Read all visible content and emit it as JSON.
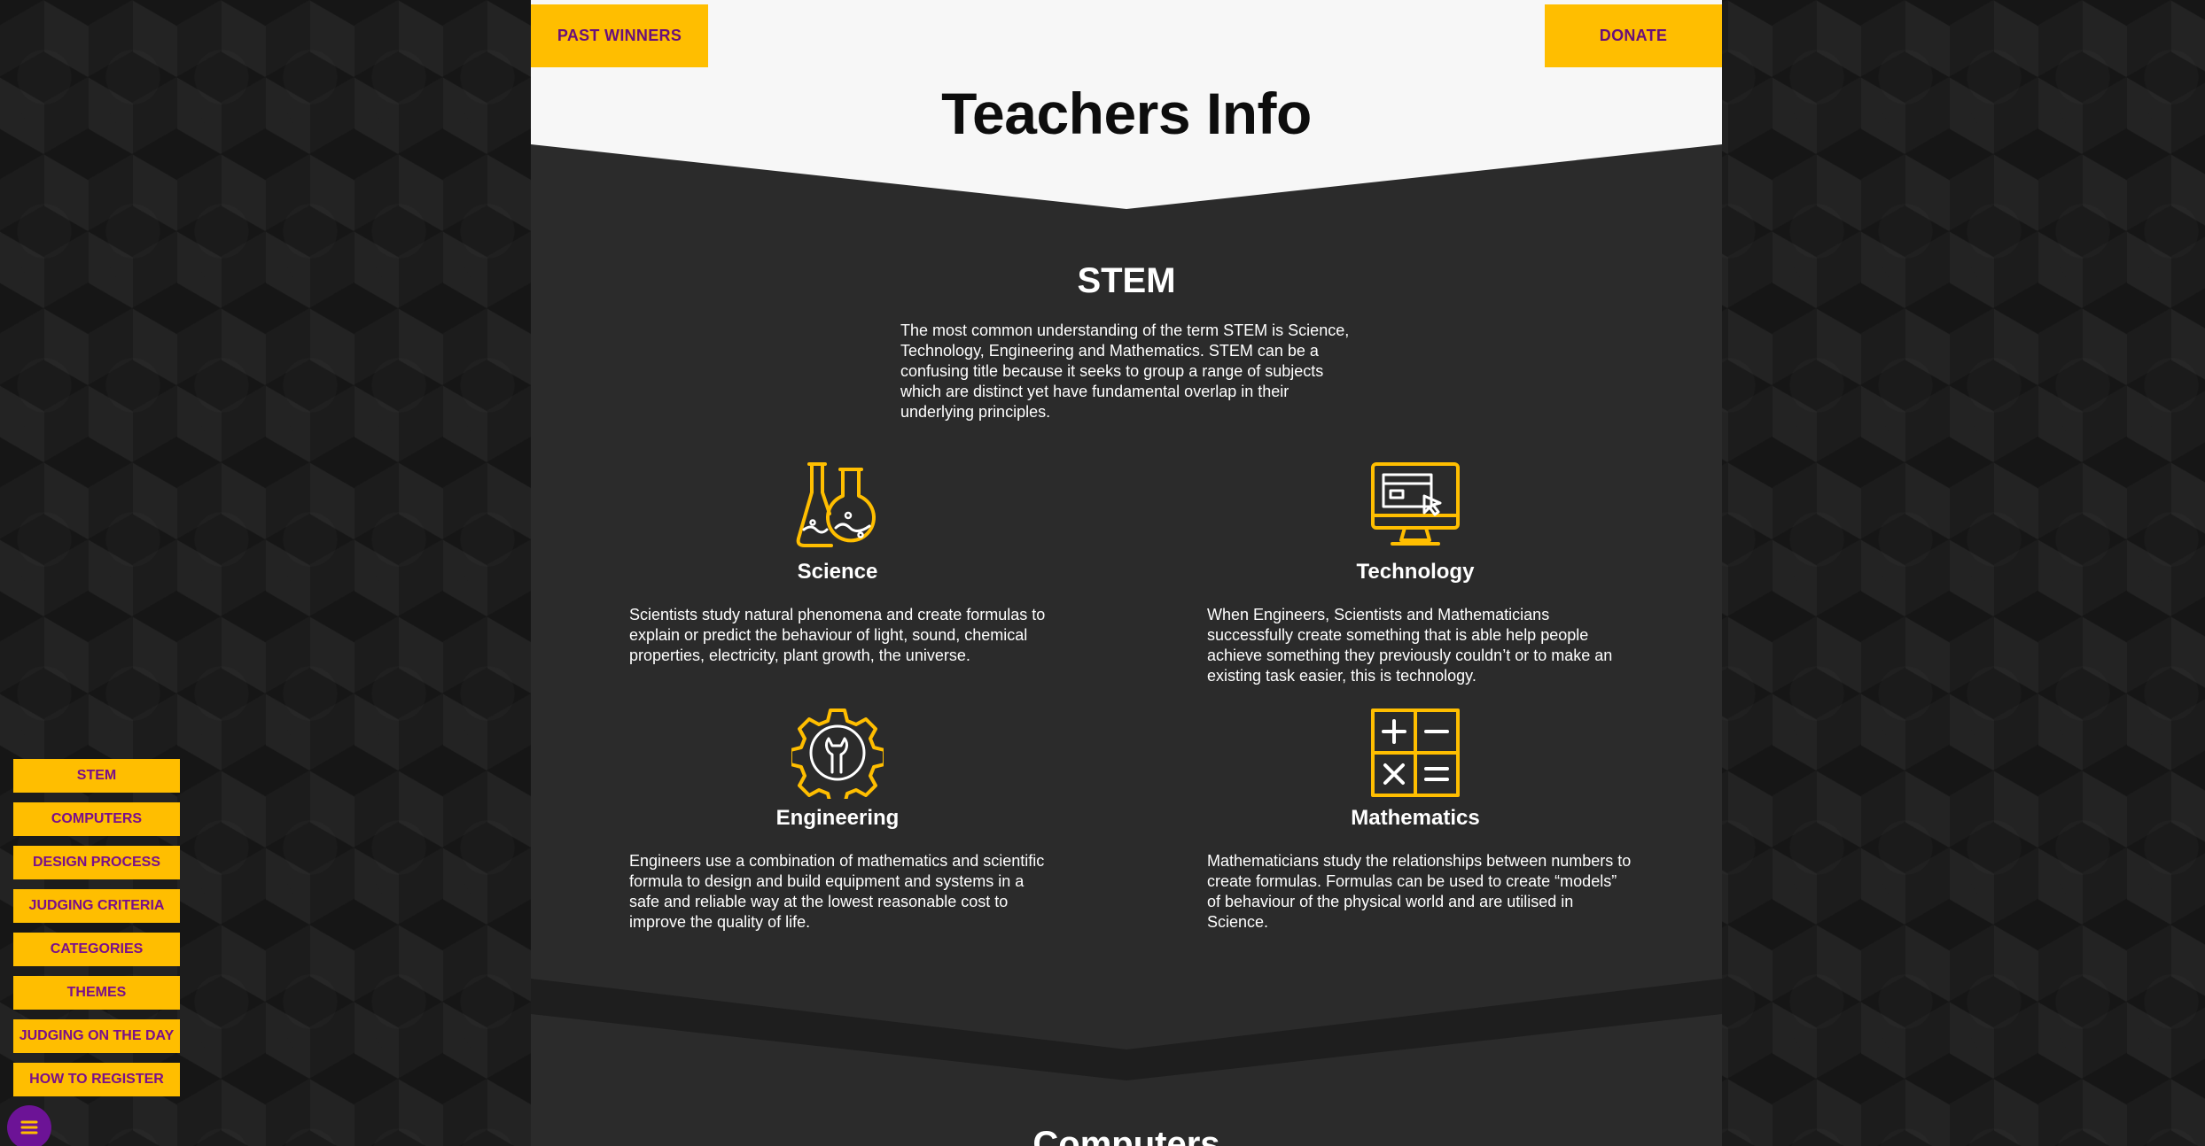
{
  "header": {
    "past_winners_label": "PAST WINNERS",
    "donate_label": "DONATE",
    "page_title": "Teachers Info"
  },
  "stem": {
    "title": "STEM",
    "intro": "The most common understanding of the term STEM is Science, Technology, Engineering and Mathematics. STEM can be a confusing title because it seeks to group a range of subjects which are distinct yet have fundamental overlap in their underlying principles."
  },
  "cards": {
    "science": {
      "icon": "flasks-icon",
      "title": "Science",
      "text": "Scientists study natural phenomena and create formulas to explain or predict the behaviour of light, sound, chemical properties, electricity, plant growth, the universe."
    },
    "technology": {
      "icon": "computer-monitor-icon",
      "title": "Technology",
      "text": "When Engineers, Scientists and Mathematicians successfully create something that is able help people achieve something they previously couldn’t or to make an existing task easier, this is technology."
    },
    "engineering": {
      "icon": "gear-wrench-icon",
      "title": "Engineering",
      "text": "Engineers use a combination of mathematics and scientific formula to design and build equipment and systems in a safe and reliable way at the lowest reasonable cost to improve the quality of life."
    },
    "mathematics": {
      "icon": "calculator-symbols-icon",
      "title": "Mathematics",
      "text": "Mathematicians study the relationships between numbers to create formulas. Formulas can be used to create “models” of behaviour of the physical world and are utilised in Science."
    }
  },
  "next_section": {
    "title": "Computers"
  },
  "side_nav": {
    "items": [
      "STEM",
      "COMPUTERS",
      "DESIGN PROCESS",
      "JUDGING CRITERIA",
      "CATEGORIES",
      "THEMES",
      "JUDGING ON THE DAY",
      "HOW TO REGISTER"
    ]
  },
  "colors": {
    "accent_yellow": "#ffbe00",
    "accent_purple": "#6c1396",
    "panel_dark": "#2b2b2b"
  }
}
